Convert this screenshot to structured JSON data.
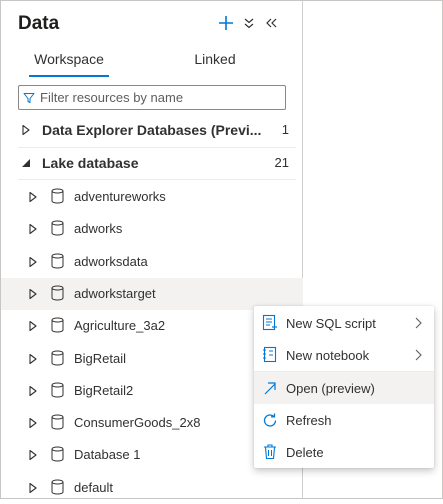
{
  "panel": {
    "title": "Data",
    "header_icons": [
      "add-icon",
      "collapse-all-icon",
      "collapse-panel-icon"
    ]
  },
  "tabs": [
    {
      "label": "Workspace",
      "active": true
    },
    {
      "label": "Linked",
      "active": false
    }
  ],
  "filter": {
    "placeholder": "Filter resources by name",
    "value": "",
    "icon": "filter-icon"
  },
  "sections": [
    {
      "label": "Data Explorer Databases (Previ...",
      "count": "1",
      "expanded": false
    },
    {
      "label": "Lake database",
      "count": "21",
      "expanded": true
    }
  ],
  "databases": [
    {
      "name": "adventureworks",
      "hovered": false
    },
    {
      "name": "adworks",
      "hovered": false
    },
    {
      "name": "adworksdata",
      "hovered": false
    },
    {
      "name": "adworkstarget",
      "hovered": true
    },
    {
      "name": "Agriculture_3a2",
      "hovered": false
    },
    {
      "name": "BigRetail",
      "hovered": false
    },
    {
      "name": "BigRetail2",
      "hovered": false
    },
    {
      "name": "ConsumerGoods_2x8",
      "hovered": false
    },
    {
      "name": "Database 1",
      "hovered": false
    },
    {
      "name": "default",
      "hovered": false
    }
  ],
  "context_menu": {
    "items": [
      {
        "label": "New SQL script",
        "icon": "sql-script-icon",
        "submenu": true
      },
      {
        "label": "New notebook",
        "icon": "notebook-icon",
        "submenu": true
      },
      {
        "label": "Open (preview)",
        "icon": "open-arrow-icon",
        "submenu": false,
        "hovered": true
      },
      {
        "label": "Refresh",
        "icon": "refresh-icon",
        "submenu": false
      },
      {
        "label": "Delete",
        "icon": "delete-icon",
        "submenu": false
      }
    ]
  },
  "colors": {
    "accent": "#0078d4",
    "text": "#323130",
    "hover": "#f3f2f1"
  }
}
